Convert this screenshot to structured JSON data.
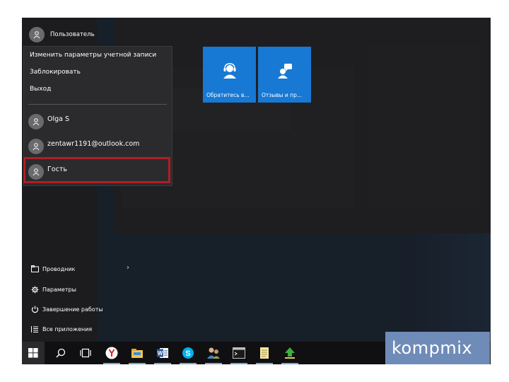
{
  "start_menu": {
    "user_name": "Пользователь",
    "account_menu": {
      "items": [
        "Изменить параметры учетной записи",
        "Заблокировать",
        "Выход"
      ],
      "users": [
        "Olga S",
        "zentawr1191@outlook.com",
        "Гость"
      ]
    },
    "left_items": [
      {
        "label": "Проводник",
        "icon": "folder-icon"
      },
      {
        "label": "Параметры",
        "icon": "gear-icon"
      },
      {
        "label": "Завершение работы",
        "icon": "power-icon"
      },
      {
        "label": "Все приложения",
        "icon": "list-icon"
      }
    ],
    "tiles": [
      {
        "label": "Обратитесь в...",
        "icon": "contact-support-icon",
        "color": "#1779d4"
      },
      {
        "label": "Отзывы и пр...",
        "icon": "feedback-icon",
        "color": "#1779d4"
      }
    ]
  },
  "taskbar": {
    "apps": [
      "start-icon",
      "search-icon",
      "task-view-icon",
      "yandex-browser-icon",
      "file-explorer-icon",
      "word-icon",
      "skype-icon",
      "people-icon",
      "command-prompt-icon",
      "notepad-icon",
      "upload-icon"
    ]
  },
  "watermark": "kompmix",
  "colors": {
    "highlight": "#b01e24",
    "tile": "#1779d4",
    "menu_bg": "#1c1c1e"
  }
}
